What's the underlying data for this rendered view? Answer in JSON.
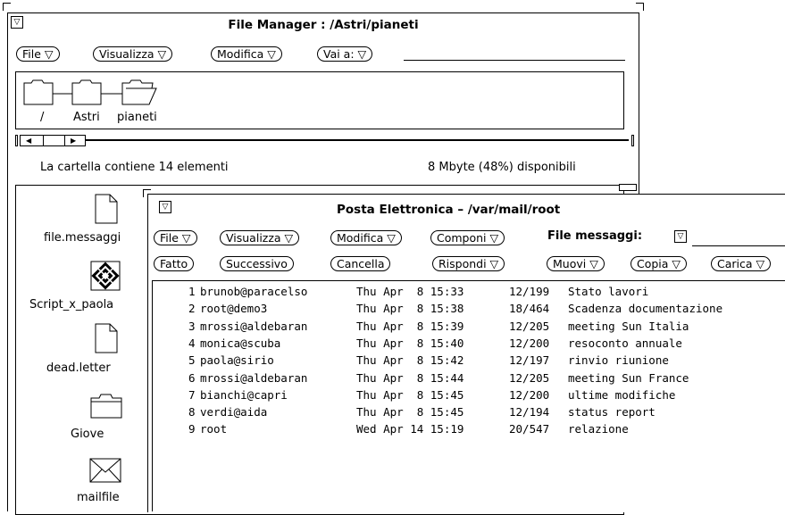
{
  "fm": {
    "title": "File Manager : /Astri/pianeti",
    "menus": [
      "File ▽",
      "Visualizza ▽",
      "Modifica ▽",
      "Vai a: ▽"
    ],
    "path": [
      "/",
      "Astri",
      "pianeti"
    ],
    "status_left": "La cartella contiene 14 elementi",
    "status_right": "8 Mbyte (48%) disponibili",
    "files": [
      {
        "name": "file.messaggi",
        "icon": "document-icon"
      },
      {
        "name": "Script_x_paola",
        "icon": "script-icon"
      },
      {
        "name": "dead.letter",
        "icon": "document-icon"
      },
      {
        "name": "Giove",
        "icon": "folder-icon"
      },
      {
        "name": "mailfile",
        "icon": "mail-envelope-icon"
      }
    ]
  },
  "mail": {
    "title": "Posta Elettronica – /var/mail/root",
    "menus1": [
      "File ▽",
      "Visualizza ▽",
      "Modifica ▽",
      "Componi ▽"
    ],
    "file_messaggi_label": "File messaggi:",
    "menus2": [
      "Fatto",
      "Successivo",
      "Cancella",
      "Rispondi ▽",
      "Muovi ▽",
      "Copia ▽",
      "Carica ▽"
    ],
    "messages": [
      {
        "n": "1",
        "from": "brunob@paracelso",
        "date": "Thu Apr  8 15:33",
        "size": "12/199",
        "subject": "Stato lavori"
      },
      {
        "n": "2",
        "from": "root@demo3",
        "date": "Thu Apr  8 15:38",
        "size": "18/464",
        "subject": "Scadenza documentazione"
      },
      {
        "n": "3",
        "from": "mrossi@aldebaran",
        "date": "Thu Apr  8 15:39",
        "size": "12/205",
        "subject": "meeting Sun Italia"
      },
      {
        "n": "4",
        "from": "monica@scuba",
        "date": "Thu Apr  8 15:40",
        "size": "12/200",
        "subject": "resoconto annuale"
      },
      {
        "n": "5",
        "from": "paola@sirio",
        "date": "Thu Apr  8 15:42",
        "size": "12/197",
        "subject": "rinvio riunione"
      },
      {
        "n": "6",
        "from": "mrossi@aldebaran",
        "date": "Thu Apr  8 15:44",
        "size": "12/205",
        "subject": "meeting Sun France"
      },
      {
        "n": "7",
        "from": "bianchi@capri",
        "date": "Thu Apr  8 15:45",
        "size": "12/200",
        "subject": "ultime modifiche"
      },
      {
        "n": "8",
        "from": "verdi@aida",
        "date": "Thu Apr  8 15:45",
        "size": "12/194",
        "subject": "status report"
      },
      {
        "n": "9",
        "from": "root",
        "date": "Wed Apr 14 15:19",
        "size": "20/547",
        "subject": "relazione"
      }
    ]
  }
}
